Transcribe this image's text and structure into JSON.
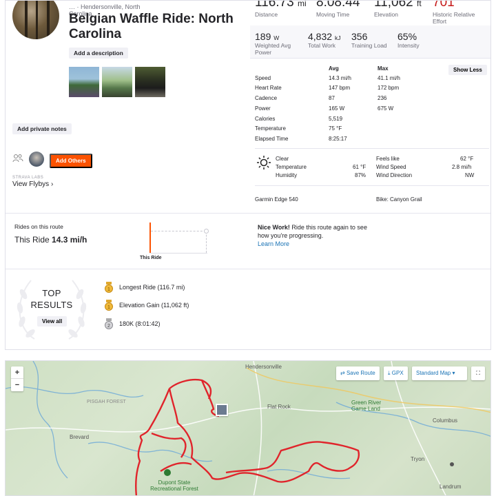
{
  "header": {
    "subline": "… · Hendersonville, North",
    "subline2": "Carolina",
    "title": "Belgian Waffle Ride: North Carolina",
    "add_description": "Add a description",
    "add_private_notes": "Add private notes",
    "add_others": "Add Others",
    "labs_label": "STRAVA LABS",
    "flybys": "View Flybys ›"
  },
  "stats_top": [
    {
      "value": "116.73",
      "unit": "mi",
      "label": "Distance"
    },
    {
      "value": "8:08:44",
      "unit": "",
      "label": "Moving Time"
    },
    {
      "value": "11,062",
      "unit": "ft",
      "label": "Elevation"
    },
    {
      "value": "701",
      "unit": "",
      "label": "Historic Relative Effort"
    }
  ],
  "stats_mid": [
    {
      "value": "189",
      "unit": "W",
      "label": "Weighted Avg Power"
    },
    {
      "value": "4,832",
      "unit": "kJ",
      "label": "Total Work"
    },
    {
      "value": "356",
      "unit": "",
      "label": "Training Load"
    },
    {
      "value": "65%",
      "unit": "",
      "label": "Intensity"
    }
  ],
  "table": {
    "avg_header": "Avg",
    "max_header": "Max",
    "show_less": "Show Less",
    "rows": [
      {
        "name": "Speed",
        "avg": "14.3 mi/h",
        "max": "41.1 mi/h"
      },
      {
        "name": "Heart Rate",
        "avg": "147 bpm",
        "max": "172 bpm"
      },
      {
        "name": "Cadence",
        "avg": "87",
        "max": "236"
      },
      {
        "name": "Power",
        "avg": "165 W",
        "max": "675 W"
      },
      {
        "name": "Calories",
        "avg": "5,519",
        "max": ""
      },
      {
        "name": "Temperature",
        "avg": "75 °F",
        "max": ""
      },
      {
        "name": "Elapsed Time",
        "avg": "8:25:17",
        "max": ""
      }
    ]
  },
  "weather": {
    "condition": "Clear",
    "temp_label": "Temperature",
    "temp_value": "61 °F",
    "humidity_label": "Humidity",
    "humidity_value": "87%",
    "feels_label": "Feels like",
    "feels_value": "62 °F",
    "wind_speed_label": "Wind Speed",
    "wind_speed_value": "2.8 mi/h",
    "wind_dir_label": "Wind Direction",
    "wind_dir_value": "NW"
  },
  "device": "Garmin Edge 540",
  "bike": "Bike: Canyon Grail",
  "route": {
    "label": "Rides on this route",
    "value_prefix": "This Ride",
    "value": "14.3 mi/h",
    "this_ride": "This Ride",
    "nice_bold": "Nice Work!",
    "nice_text": "Ride this route again to see how you're progressing.",
    "learn_more": "Learn More"
  },
  "top_results": {
    "title_line1": "TOP",
    "title_line2": "RESULTS",
    "view_all": "View all",
    "items": [
      {
        "text": "Longest Ride  (116.7 mi)",
        "medal": "gold"
      },
      {
        "text": "Elevation Gain  (11,062 ft)",
        "medal": "gold"
      },
      {
        "text": "180K  (8:01:42)",
        "medal": "silver"
      }
    ]
  },
  "map": {
    "zoom_in": "+",
    "zoom_out": "−",
    "save_route": "Save Route",
    "gpx": "GPX",
    "map_type": "Standard Map",
    "places": [
      "Hendersonville",
      "PISGAH FOREST",
      "Brevard",
      "Flat Rock",
      "Green River Game Land",
      "Columbus",
      "Tryon",
      "Landrum",
      "Dupont State Recreational Forest"
    ]
  },
  "colors": {
    "accent": "#fc5200",
    "route": "#e0242b",
    "link": "#1a73b5",
    "effort": "#c51a1a"
  }
}
